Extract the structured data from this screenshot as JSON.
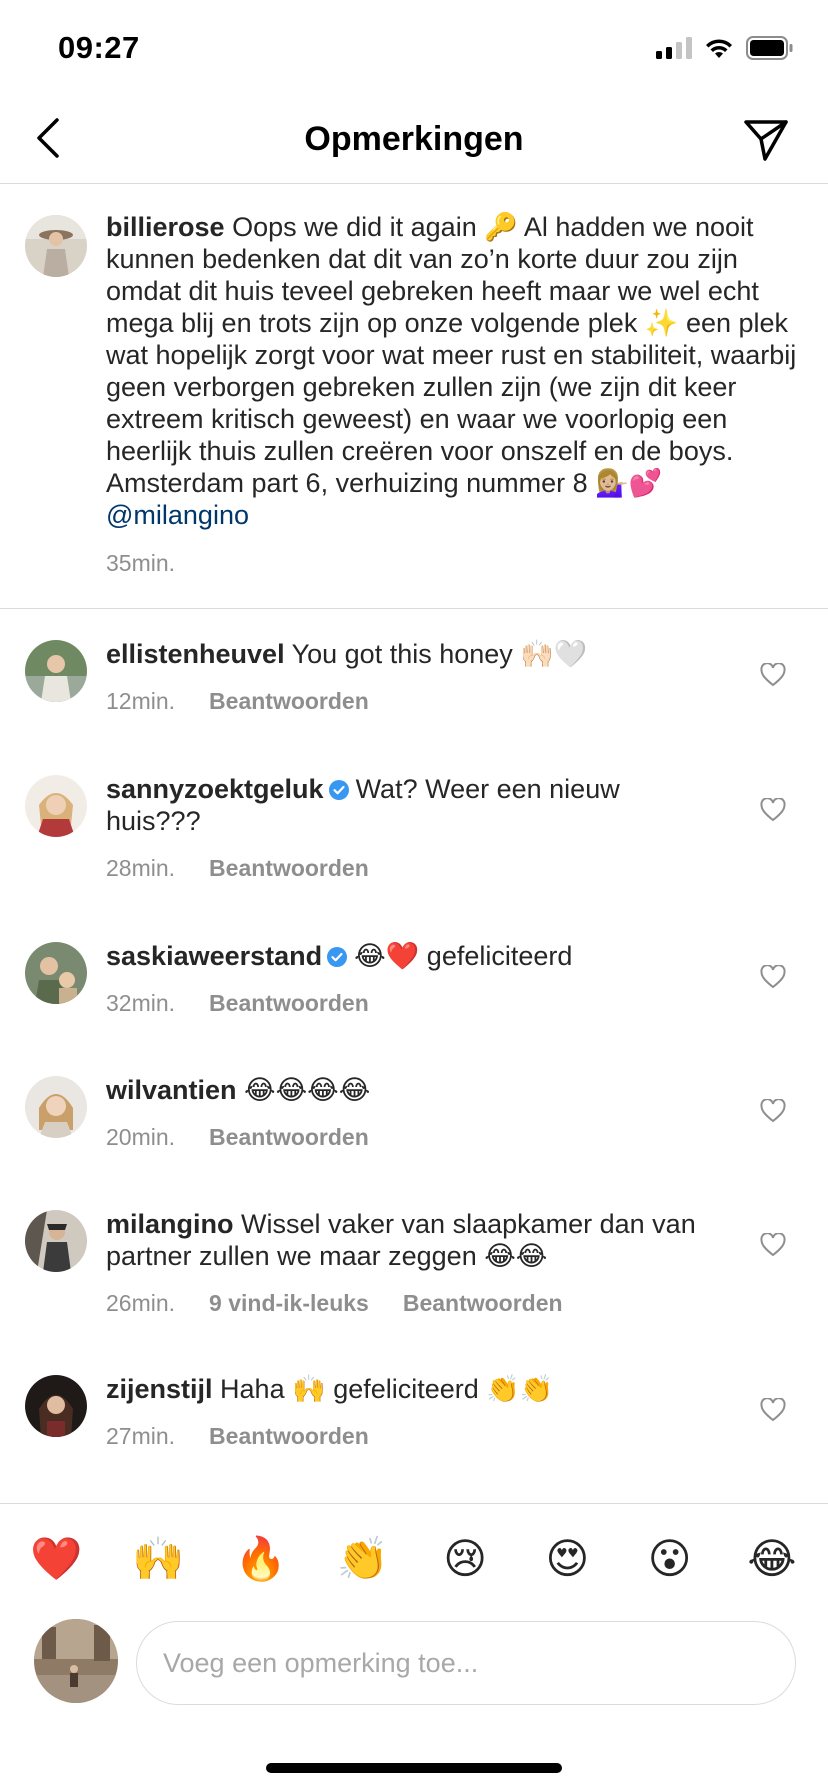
{
  "status_bar": {
    "time": "09:27"
  },
  "header": {
    "title": "Opmerkingen"
  },
  "caption": {
    "username": "billierose",
    "text": "Oops we did it again 🔑 Al hadden we nooit kunnen bedenken dat dit van zo’n korte duur zou zijn omdat dit huis teveel gebreken heeft maar we wel echt mega blij en trots zijn op onze volgende plek ✨ een plek wat hopelijk zorgt voor wat meer rust en stabiliteit, waarbij geen verborgen gebreken zullen zijn (we zijn dit keer extreem kritisch geweest) en waar we voorlopig een heerlijk thuis zullen creëren voor onszelf en de boys. Amsterdam part 6, verhuizing nummer 8 💁🏼‍♀️💕 ",
    "mention": "@milangino",
    "time": "35min."
  },
  "comments": [
    {
      "username": "ellistenheuvel",
      "verified": false,
      "text": "You got this honey 🙌🏻🤍",
      "time": "12min.",
      "likes": "",
      "reply": "Beantwoorden"
    },
    {
      "username": "sannyzoektgeluk",
      "verified": true,
      "text": "Wat? Weer een nieuw huis???",
      "time": "28min.",
      "likes": "",
      "reply": "Beantwoorden"
    },
    {
      "username": "saskiaweerstand",
      "verified": true,
      "text": "😂❤️ gefeliciteerd",
      "time": "32min.",
      "likes": "",
      "reply": "Beantwoorden"
    },
    {
      "username": "wilvantien",
      "verified": false,
      "text": "😂😂😂😂",
      "time": "20min.",
      "likes": "",
      "reply": "Beantwoorden"
    },
    {
      "username": "milangino",
      "verified": false,
      "text": "Wissel vaker van slaapkamer dan van partner zullen we maar zeggen 😂😂",
      "time": "26min.",
      "likes": "9 vind-ik-leuks",
      "reply": "Beantwoorden"
    },
    {
      "username": "zijenstijl",
      "verified": false,
      "text": "Haha 🙌 gefeliciteerd 👏👏",
      "time": "27min.",
      "likes": "",
      "reply": "Beantwoorden"
    }
  ],
  "emoji_bar": [
    "❤️",
    "🙌",
    "🔥",
    "👏",
    "😢",
    "😍",
    "😮",
    "😂"
  ],
  "input": {
    "placeholder": "Voeg een opmerking toe..."
  },
  "colors": {
    "verified": "#3897f0",
    "mention": "#00376b",
    "meta": "#8e8e8e",
    "divider": "#dbdbdb"
  }
}
